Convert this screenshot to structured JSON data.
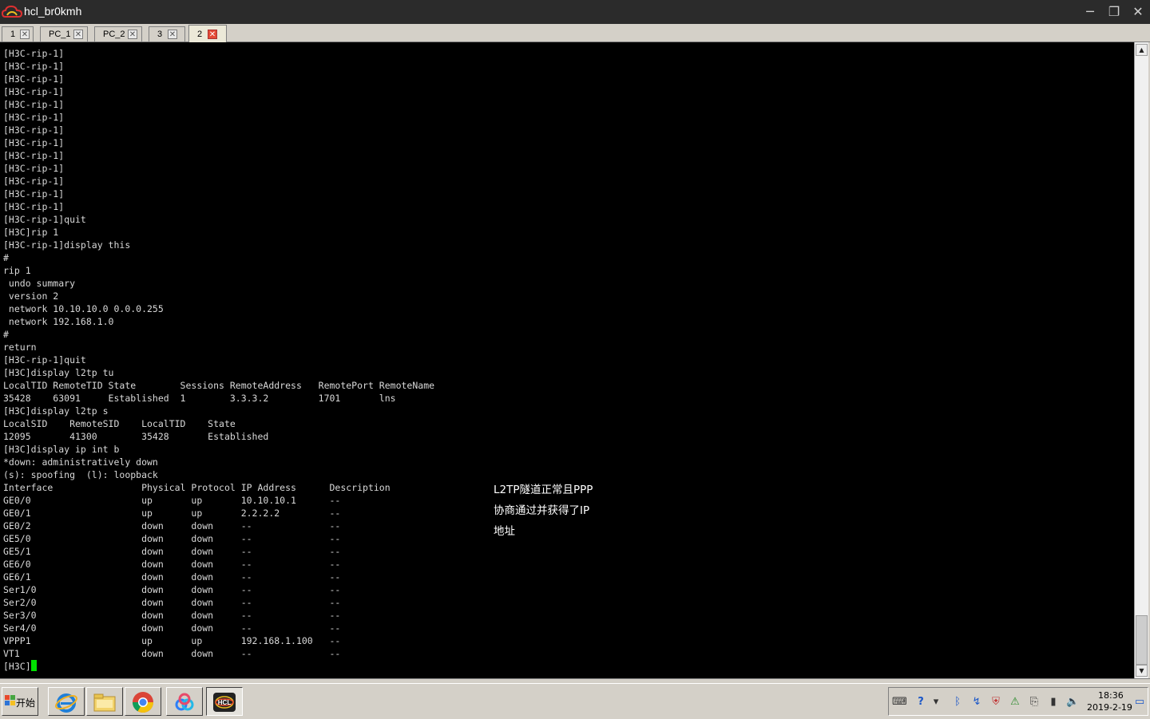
{
  "window": {
    "title": "hcl_br0kmh",
    "minimize_glyph": "─",
    "maximize_glyph": "❐",
    "close_glyph": "✕"
  },
  "tabs": [
    {
      "label": "1",
      "close_glyph": "✕",
      "active": false
    },
    {
      "label": "PC_1",
      "close_glyph": "✕",
      "active": false
    },
    {
      "label": "PC_2",
      "close_glyph": "✕",
      "active": false
    },
    {
      "label": "3",
      "close_glyph": "✕",
      "active": false
    },
    {
      "label": "2",
      "close_glyph": "✕",
      "active": true
    }
  ],
  "terminal": {
    "lines": [
      "[H3C-rip-1]",
      "[H3C-rip-1]",
      "[H3C-rip-1]",
      "[H3C-rip-1]",
      "[H3C-rip-1]",
      "[H3C-rip-1]",
      "[H3C-rip-1]",
      "[H3C-rip-1]",
      "[H3C-rip-1]",
      "[H3C-rip-1]",
      "[H3C-rip-1]",
      "[H3C-rip-1]",
      "[H3C-rip-1]",
      "[H3C-rip-1]quit",
      "[H3C]rip 1",
      "[H3C-rip-1]display this",
      "#",
      "rip 1",
      " undo summary",
      " version 2",
      " network 10.10.10.0 0.0.0.255",
      " network 192.168.1.0",
      "#",
      "return",
      "[H3C-rip-1]quit",
      "[H3C]display l2tp tu",
      "LocalTID RemoteTID State        Sessions RemoteAddress   RemotePort RemoteName",
      "35428    63091     Established  1        3.3.3.2         1701       lns",
      "[H3C]display l2tp s",
      "LocalSID    RemoteSID    LocalTID    State",
      "12095       41300        35428       Established",
      "[H3C]display ip int b",
      "*down: administratively down",
      "(s): spoofing  (l): loopback",
      "Interface                Physical Protocol IP Address      Description",
      "GE0/0                    up       up       10.10.10.1      --",
      "GE0/1                    up       up       2.2.2.2         --",
      "GE0/2                    down     down     --              --",
      "GE5/0                    down     down     --              --",
      "GE5/1                    down     down     --              --",
      "GE6/0                    down     down     --              --",
      "GE6/1                    down     down     --              --",
      "Ser1/0                   down     down     --              --",
      "Ser2/0                   down     down     --              --",
      "Ser3/0                   down     down     --              --",
      "Ser4/0                   down     down     --              --",
      "VPPP1                    up       up       192.168.1.100   --",
      "VT1                      down     down     --              --"
    ],
    "prompt": "[H3C]",
    "cursor_color": "#00e000",
    "annotation": "L2TP隧道正常且PPP\n协商通过并获得了IP\n地址"
  },
  "scrollbar": {
    "up_glyph": "▲",
    "down_glyph": "▼"
  },
  "taskbar": {
    "start_label": "开始",
    "apps": [
      {
        "name": "internet-explorer-icon",
        "active": false
      },
      {
        "name": "file-explorer-icon",
        "active": false
      },
      {
        "name": "chrome-icon",
        "active": false
      },
      {
        "name": "baidu-netdisk-icon",
        "active": false
      },
      {
        "name": "hcl-icon",
        "active": true,
        "label": "HCL"
      }
    ],
    "tray_icons": [
      {
        "name": "keyboard-icon",
        "glyph": "⌨"
      },
      {
        "name": "help-icon",
        "glyph": "?"
      },
      {
        "name": "tray-arrow-icon",
        "glyph": "▾"
      },
      {
        "name": "bluetooth-icon",
        "glyph": "ᛒ"
      },
      {
        "name": "sync-icon",
        "glyph": "↯"
      },
      {
        "name": "security-icon",
        "glyph": "⛨"
      },
      {
        "name": "network-status-icon",
        "glyph": "⚠"
      },
      {
        "name": "usb-icon",
        "glyph": "⎘"
      },
      {
        "name": "signal-icon",
        "glyph": "▮"
      },
      {
        "name": "volume-icon",
        "glyph": "🔈"
      }
    ],
    "clock_time": "18:36",
    "clock_date": "2019-2-19",
    "show_desktop_glyph": "▭"
  }
}
